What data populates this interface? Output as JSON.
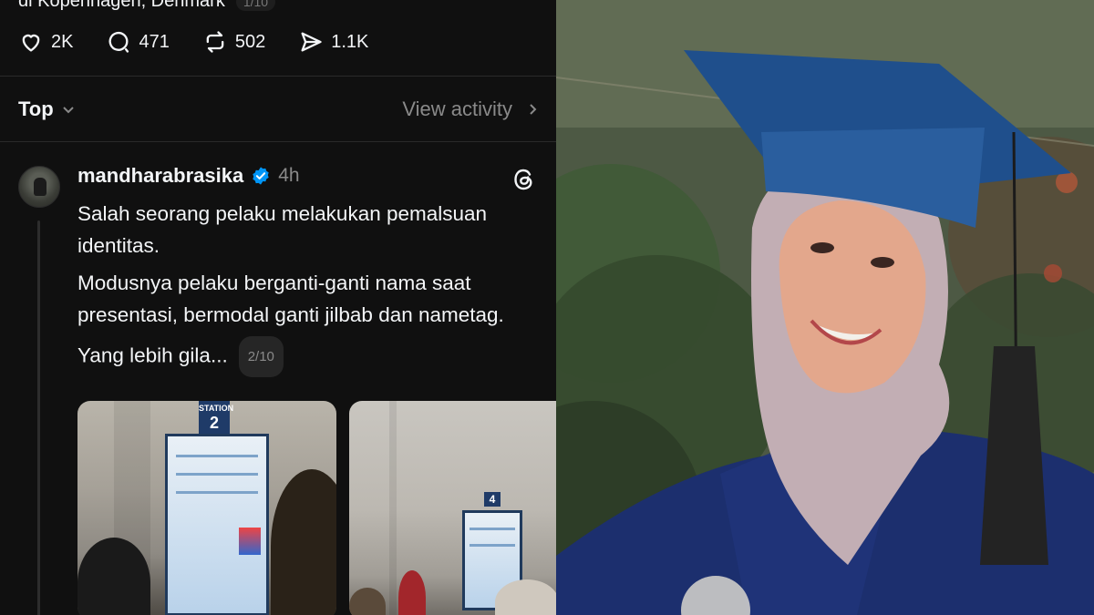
{
  "post": {
    "prev_caption": "di Kopenhagen, Denmark",
    "prev_counter": "1/10",
    "actions": {
      "likes": "2K",
      "comments": "471",
      "reposts": "502",
      "shares": "1.1K"
    }
  },
  "sort_bar": {
    "sort_label": "Top",
    "view_activity_label": "View activity"
  },
  "reply": {
    "username": "mandharabrasika",
    "time": "4h",
    "lines": [
      "Salah seorang pelaku melakukan pemalsuan identitas.",
      "Modusnya pelaku berganti-ganti nama saat presentasi, bermodal ganti jilbab dan nametag.",
      "Yang lebih gila..."
    ],
    "pager": "2/10",
    "photos": [
      {
        "station_label": "STATION",
        "station_number": "2"
      },
      {
        "station_number": "4"
      }
    ]
  },
  "colors": {
    "background": "#101010",
    "text": "#f3f5f7",
    "muted": "#8a8a8a",
    "verified": "#0095f6"
  },
  "icons": [
    "heart-icon",
    "comment-icon",
    "repost-icon",
    "share-icon",
    "chevron-down-icon",
    "chevron-right-icon",
    "verified-badge-icon",
    "threads-logo-icon"
  ]
}
